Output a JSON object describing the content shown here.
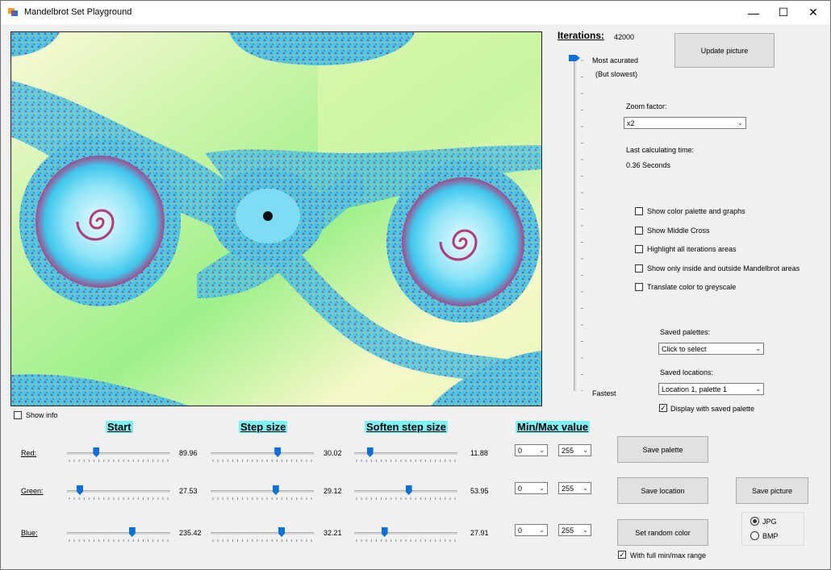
{
  "window": {
    "title": "Mandelbrot Set Playground",
    "minimize": "—",
    "maximize": "☐",
    "close": "✕"
  },
  "iterations": {
    "label": "Iterations:",
    "value": "42000",
    "most_accurate": "Most acurated",
    "but_slowest": "(But slowest)",
    "fastest": "Fastest",
    "slider_level": 0
  },
  "update_button": "Update picture",
  "zoom": {
    "label": "Zoom factor:",
    "selected": "x2"
  },
  "calc_time": {
    "label": "Last calculating time:",
    "value": "0.36 Seconds"
  },
  "options": [
    {
      "label": "Show color palette and graphs",
      "checked": false
    },
    {
      "label": "Show Middle Cross",
      "checked": false
    },
    {
      "label": "Highlight all iterations areas",
      "checked": false
    },
    {
      "label": "Show only inside and outside Mandelbrot areas",
      "checked": false
    },
    {
      "label": "Translate color to greyscale",
      "checked": false
    }
  ],
  "saved_palettes": {
    "label": "Saved palettes:",
    "selected": "Click to select"
  },
  "saved_locations": {
    "label": "Saved locations:",
    "selected": "Location 1, palette 1"
  },
  "display_saved_palette": {
    "label": "Display with saved palette",
    "checked": true
  },
  "show_info": {
    "label": "Show info",
    "checked": false
  },
  "headers": {
    "start": "Start",
    "step": "Step size",
    "soften": "Soften step size",
    "minmax": "Min/Max value"
  },
  "channels": [
    {
      "name": "Red:",
      "start": "89.96",
      "start_level": 0.27,
      "step": "30.02",
      "step_level": 0.66,
      "soften": "11.88",
      "soften_level": 0.13,
      "min": "0",
      "max": "255"
    },
    {
      "name": "Green:",
      "start": "27.53",
      "start_level": 0.1,
      "step": "29.12",
      "step_level": 0.64,
      "soften": "53.95",
      "soften_level": 0.53,
      "min": "0",
      "max": "255"
    },
    {
      "name": "Blue:",
      "start": "235.42",
      "start_level": 0.64,
      "step": "32.21",
      "step_level": 0.7,
      "soften": "27.91",
      "soften_level": 0.28,
      "min": "0",
      "max": "255"
    }
  ],
  "buttons": {
    "save_palette": "Save  palette",
    "save_location": "Save location",
    "save_picture": "Save picture",
    "set_random_color": "Set random color"
  },
  "full_range": {
    "label": "With full min/max range",
    "checked": true
  },
  "format": {
    "jpg": "JPG",
    "bmp": "BMP",
    "selected": "JPG"
  },
  "colors": {
    "accent": "#0d6fd8",
    "header_bg": "#7cf3f7",
    "fractal_cyan": "#56d8f2",
    "fractal_green": "#9ef08a",
    "fractal_cream": "#fbf9d6"
  }
}
